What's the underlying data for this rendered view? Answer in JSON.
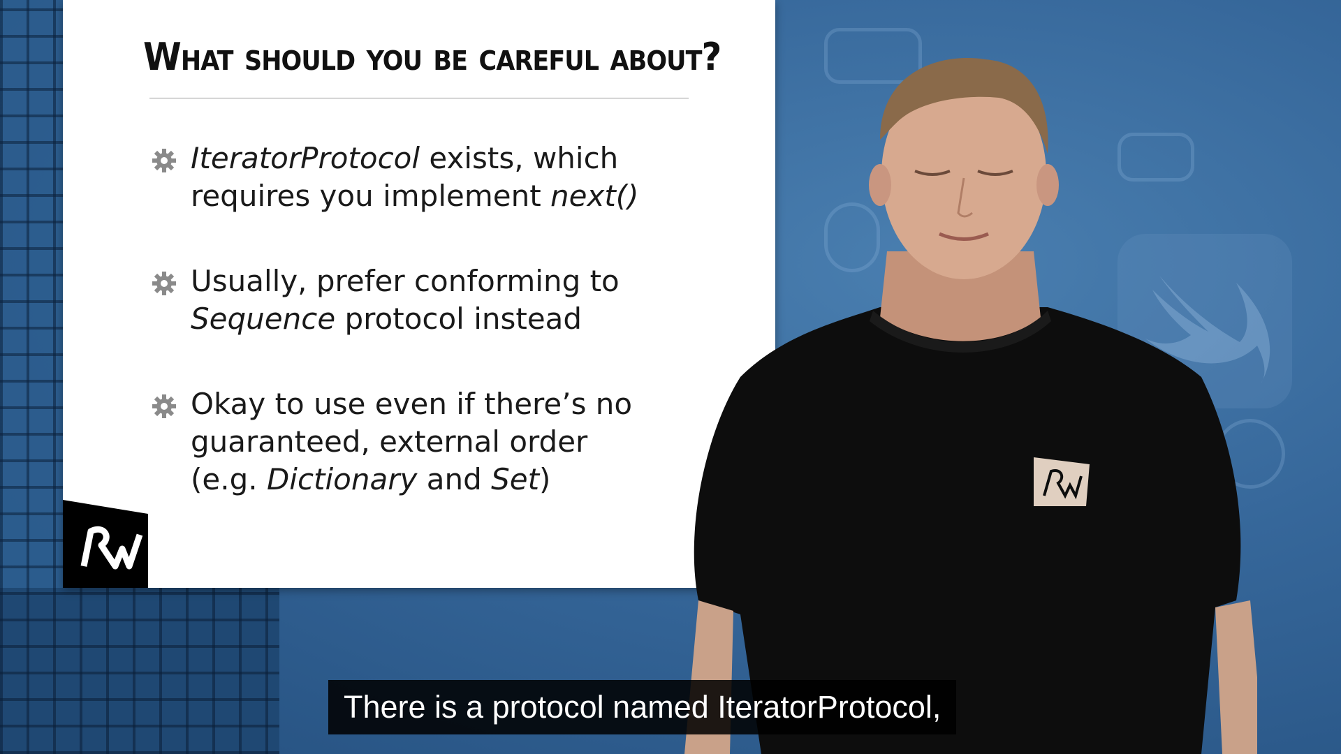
{
  "slide": {
    "title": "What should you be careful about?",
    "bullets": [
      {
        "line1_italic": "IteratorProtocol",
        "line1_rest": " exists, which",
        "line2_plain": "requires you implement ",
        "line2_italic": "next()"
      },
      {
        "line1": "Usually, prefer conforming to",
        "line2_italic": "Sequence",
        "line2_rest": " protocol instead"
      },
      {
        "line1": "Okay to use even if there’s no",
        "line2": "guaranteed, external order",
        "line3_a": "(e.g. ",
        "line3_b_italic": "Dictionary",
        "line3_c": " and ",
        "line3_d_italic": "Set",
        "line3_e": ")"
      }
    ],
    "bullet_icon": "gear-icon"
  },
  "caption": {
    "text": "There is a protocol named IteratorProtocol,"
  },
  "colors": {
    "background_blue": "#36679a",
    "slide_bg": "#ffffff",
    "caption_bg": "#000000",
    "caption_text": "#ffffff"
  }
}
